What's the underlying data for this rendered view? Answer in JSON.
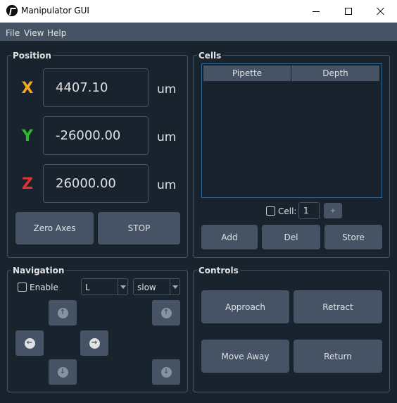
{
  "window": {
    "title": "Manipulator GUI"
  },
  "menu": {
    "items": [
      {
        "label": "File"
      },
      {
        "label": "View"
      },
      {
        "label": "Help"
      }
    ]
  },
  "position": {
    "title": "Position",
    "axes": [
      {
        "letter": "X",
        "value": "4407.10",
        "unit": "um",
        "color": "#f5a623"
      },
      {
        "letter": "Y",
        "value": "-26000.00",
        "unit": "um",
        "color": "#2eb82e"
      },
      {
        "letter": "Z",
        "value": "26000.00",
        "unit": "um",
        "color": "#e03030"
      }
    ],
    "zero_label": "Zero Axes",
    "stop_label": "STOP"
  },
  "cells": {
    "title": "Cells",
    "columns": [
      "Pipette",
      "Depth"
    ],
    "cell_label": "Cell:",
    "cell_value": "1",
    "add_label": "Add",
    "del_label": "Del",
    "store_label": "Store"
  },
  "navigation": {
    "title": "Navigation",
    "enable_label": "Enable",
    "step_value": "L",
    "speed_value": "slow"
  },
  "controls": {
    "title": "Controls",
    "approach_label": "Approach",
    "retract_label": "Retract",
    "move_away_label": "Move Away",
    "return_label": "Return"
  },
  "icons": {
    "app": "manipulator-logo-icon",
    "up": "arrow-up-circle-icon",
    "down": "arrow-down-circle-icon",
    "left": "arrow-left-circle-icon",
    "right": "arrow-right-circle-icon"
  }
}
